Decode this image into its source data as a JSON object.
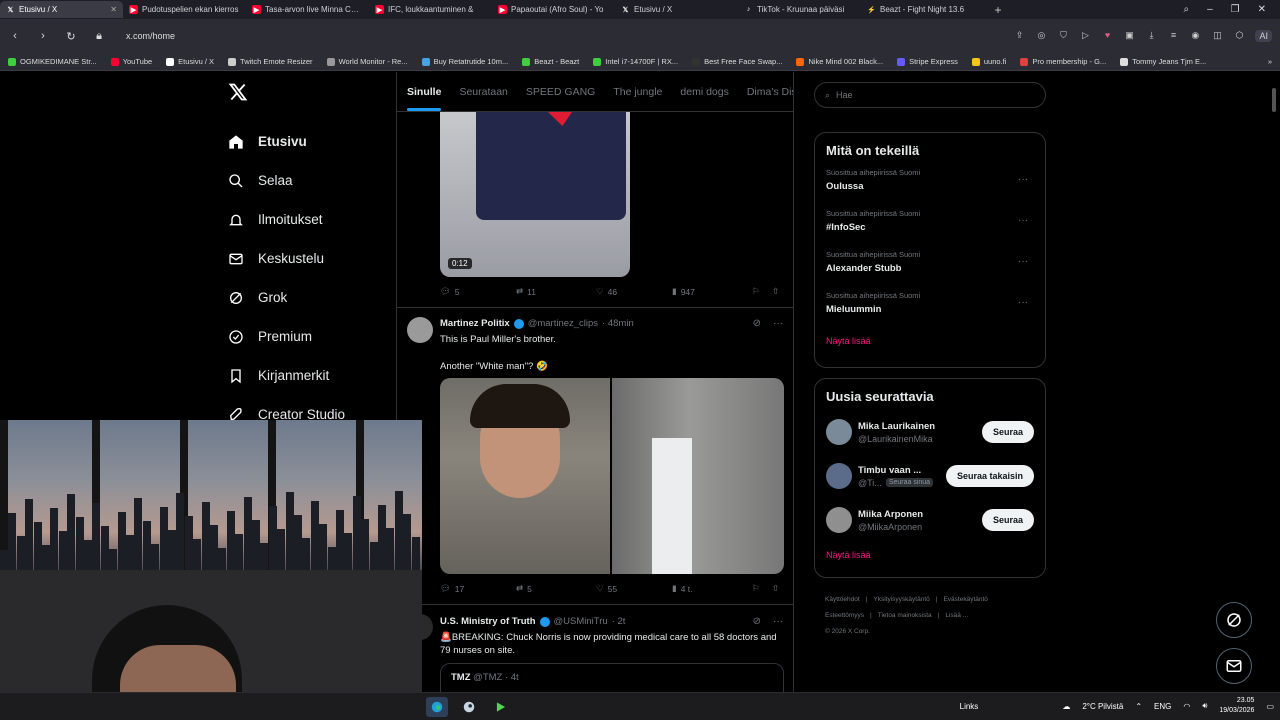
{
  "browser": {
    "tabs": [
      {
        "label": "Etusivu / X",
        "icon": "x-icon",
        "color": "#ffffff",
        "active": true
      },
      {
        "label": "Pudotuspelien ekan kierros",
        "icon": "youtube-icon",
        "color": "#ff0033"
      },
      {
        "label": "Tasa-arvon live Minna Canth",
        "icon": "youtube-icon",
        "color": "#ff0033"
      },
      {
        "label": "IFC, loukkaantuminen &",
        "icon": "youtube-icon",
        "color": "#ff0033"
      },
      {
        "label": "Papaoutai (Afro Soul) - Yo",
        "icon": "youtube-icon",
        "color": "#ff0033"
      },
      {
        "label": "Etusivu / X",
        "icon": "x-icon",
        "color": "#ffffff"
      },
      {
        "label": "TikTok - Kruunaa päiväsi",
        "icon": "tiktok-icon",
        "color": "#ffffff"
      },
      {
        "label": "Beazt - Fight Night 13.6",
        "icon": "beazt-icon",
        "color": "#3ecf3e"
      }
    ],
    "url": "x.com/home",
    "ai_label": "AI",
    "bookmarks": [
      {
        "label": "OGMIKEDIMANE Str...",
        "color": "#3ecf3e"
      },
      {
        "label": "YouTube",
        "color": "#ff0033"
      },
      {
        "label": "Etusivu / X",
        "color": "#ffffff"
      },
      {
        "label": "Twitch Emote Resizer",
        "color": "#cccccc"
      },
      {
        "label": "World Monitor - Re...",
        "color": "#999999"
      },
      {
        "label": "Buy Retatrutide 10m...",
        "color": "#4aa3df"
      },
      {
        "label": "Beazt - Beazt",
        "color": "#3ecf3e"
      },
      {
        "label": "Intel i7-14700F | RX...",
        "color": "#3ecf3e"
      },
      {
        "label": "Best Free Face Swap...",
        "color": "#333333"
      },
      {
        "label": "Nike Mind 002 Black...",
        "color": "#ff6600"
      },
      {
        "label": "Stripe Express",
        "color": "#635bff"
      },
      {
        "label": "uuno.fi",
        "color": "#f5c518"
      },
      {
        "label": "Pro membership - G...",
        "color": "#e04040"
      },
      {
        "label": "Tommy Jeans Tjm E...",
        "color": "#dddddd"
      }
    ]
  },
  "nav": {
    "items": [
      {
        "label": "Etusivu",
        "icon": "home-icon",
        "active": true
      },
      {
        "label": "Selaa",
        "icon": "search-icon"
      },
      {
        "label": "Ilmoitukset",
        "icon": "bell-icon"
      },
      {
        "label": "Keskustelu",
        "icon": "mail-icon"
      },
      {
        "label": "Grok",
        "icon": "grok-icon"
      },
      {
        "label": "Premium",
        "icon": "premium-icon"
      },
      {
        "label": "Kirjanmerkit",
        "icon": "bookmark-icon"
      },
      {
        "label": "Creator Studio",
        "icon": "rocket-icon"
      }
    ]
  },
  "feed": {
    "tabs": [
      "Sinulle",
      "Seurataan",
      "SPEED GANG",
      "The jungle",
      "demi dogs",
      "Dima's Dist"
    ],
    "post1": {
      "duration": "0:12",
      "replies": "5",
      "reposts": "11",
      "likes": "46",
      "views": "947"
    },
    "post2": {
      "name": "Martinez Politix",
      "handle": "@martinez_clips",
      "time": "· 48min",
      "line1": "This is Paul Miller's brother.",
      "line2": "Another \"White man\"? 🤣",
      "replies": "17",
      "reposts": "5",
      "likes": "55",
      "views": "4 t."
    },
    "post3": {
      "name": "U.S. Ministry of Truth",
      "handle": "@USMiniTru",
      "time": "· 2t",
      "text": "🚨BREAKING: Chuck Norris is now providing medical care to all 58 doctors and 79 nurses on site.",
      "quote_name": "TMZ",
      "quote_handle": "@TMZ · 4t"
    }
  },
  "sidebar": {
    "search_placeholder": "Hae",
    "trends_title": "Mitä on tekeillä",
    "trends": [
      {
        "context": "Suosittua aihepiirissä Suomi",
        "title": "Oulussa"
      },
      {
        "context": "Suosittua aihepiirissä Suomi",
        "title": "#InfoSec"
      },
      {
        "context": "Suosittua aihepiirissä Suomi",
        "title": "Alexander Stubb"
      },
      {
        "context": "Suosittua aihepiirissä Suomi",
        "title": "Mieluummin"
      }
    ],
    "show_more": "Näytä lisää",
    "who_title": "Uusia seurattavia",
    "who": [
      {
        "name": "Mika Laurikainen",
        "handle": "@LaurikainenMika",
        "button": "Seuraa",
        "follows_you": ""
      },
      {
        "name": "Timbu vaan ...",
        "handle": "@Ti...",
        "button": "Seuraa takaisin",
        "follows_you": "Seuraa sinua"
      },
      {
        "name": "Miika Arponen",
        "handle": "@MiikaArponen",
        "button": "Seuraa",
        "follows_you": ""
      }
    ],
    "footer": [
      "Käyttöehdot",
      "Yksityisyyskäytäntö",
      "Evästekäytäntö",
      "Esteettömyys",
      "Tietoa mainoksista",
      "Lisää ...",
      "© 2026 X Corp."
    ]
  },
  "taskbar": {
    "links": "Links",
    "weather": "2°C Pilvistä",
    "lang": "ENG",
    "time": "23.05",
    "date": "19/03/2026"
  }
}
